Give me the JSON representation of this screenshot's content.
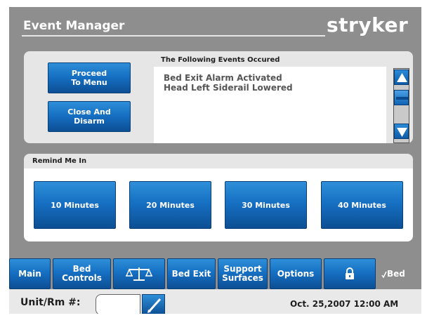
{
  "header": {
    "title": "Event Manager",
    "brand": "stryker"
  },
  "actions": {
    "proceed_label_line1": "Proceed",
    "proceed_label_line2": "To Menu",
    "close_label_line1": "Close And",
    "close_label_line2": "Disarm"
  },
  "events": {
    "heading": "The Following Events Occured",
    "items": [
      "Bed Exit Alarm Activated",
      "Head Left Siderail Lowered"
    ]
  },
  "remind": {
    "heading": "Remind Me In",
    "options": [
      "10 Minutes",
      "20 Minutes",
      "30 Minutes",
      "40 Minutes"
    ]
  },
  "nav": {
    "main": "Main",
    "bed_controls_line1": "Bed",
    "bed_controls_line2": "Controls",
    "scale_icon": "scale-icon",
    "bed_exit": "Bed Exit",
    "support_surfaces_line1": "Support",
    "support_surfaces_line2": "Surfaces",
    "options": "Options",
    "lock_icon": "lock-icon",
    "bed_status": "Bed"
  },
  "footer": {
    "unit_label": "Unit/Rm #:",
    "unit_value": "",
    "datetime": "Oct. 25,2007  12:00 AM"
  },
  "colors": {
    "background": "#8e8e8e",
    "button_blue": "#1670c3",
    "panel": "#e6e6e6"
  }
}
